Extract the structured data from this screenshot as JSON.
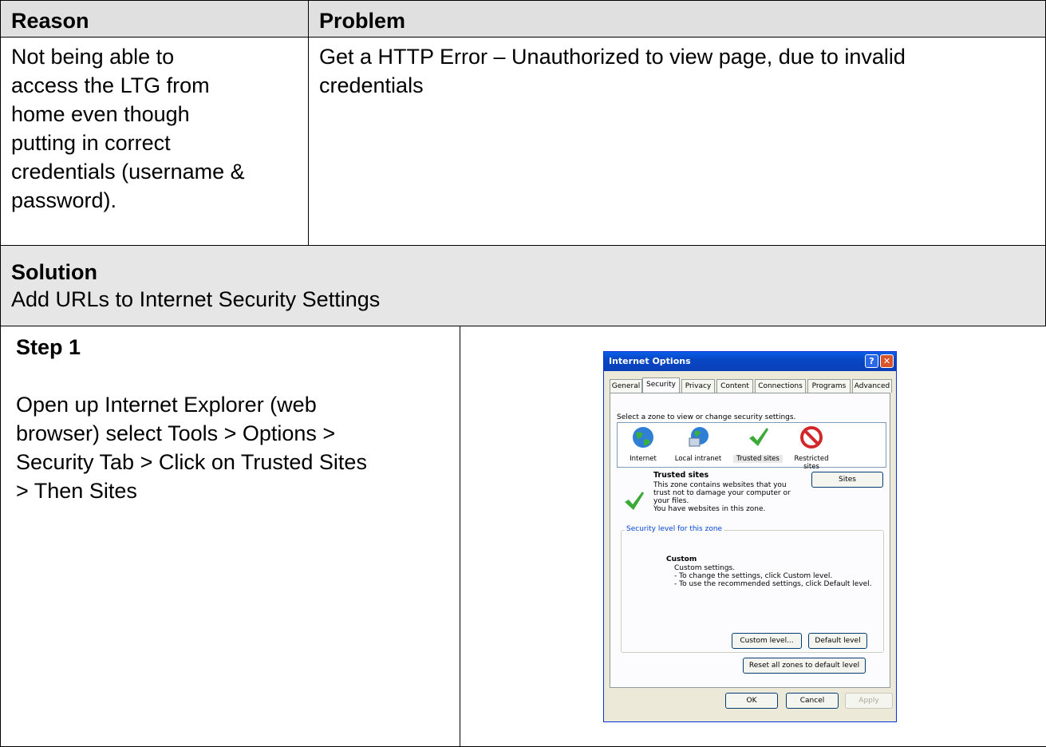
{
  "table": {
    "reason_header": "Reason",
    "problem_header": "Problem",
    "reason_lines": [
      "Not being able to",
      "access the LTG from",
      "home even though",
      "putting in correct",
      "credentials (username &",
      "password)."
    ],
    "problem_lines": [
      "Get a HTTP Error – Unauthorized to view page, due to invalid",
      "credentials"
    ],
    "solution_header": "Solution",
    "solution_text": "Add URLs to Internet Security Settings",
    "step_title": "Step 1",
    "step_lines": [
      "Open up Internet Explorer (web",
      "browser) select Tools > Options >",
      "Security Tab > Click on Trusted Sites",
      "> Then Sites"
    ]
  },
  "dialog": {
    "title": "Internet Options",
    "help_btn": "?",
    "close_btn": "✕",
    "tabs": [
      "General",
      "Security",
      "Privacy",
      "Content",
      "Connections",
      "Programs",
      "Advanced"
    ],
    "zone_prompt": "Select a zone to view or change security settings.",
    "zones": [
      "Internet",
      "Local intranet",
      "Trusted sites",
      "Restricted sites"
    ],
    "zone_title": "Trusted sites",
    "zone_desc": [
      "This zone contains websites that you",
      "trust not to damage your computer or",
      "your files.",
      "You have websites in this zone."
    ],
    "sites_btn": "Sites",
    "security_level_label": "Security level for this zone",
    "custom_title": "Custom",
    "custom_lines": [
      "Custom settings.",
      "- To change the settings, click Custom level.",
      "- To use the recommended settings, click Default level."
    ],
    "custom_level_btn": "Custom level...",
    "default_level_btn": "Default level",
    "reset_btn": "Reset all zones to default level",
    "ok_btn": "OK",
    "cancel_btn": "Cancel",
    "apply_btn": "Apply"
  },
  "colors": {
    "header_bg": "#e0e0e0",
    "titlebar": "#0a50d8",
    "dialog_bg": "#ece9d8"
  }
}
